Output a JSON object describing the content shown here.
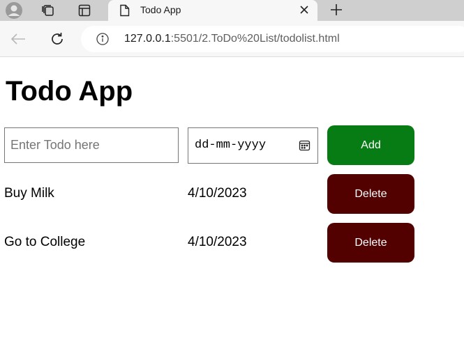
{
  "browser": {
    "tab_title": "Todo App",
    "url_host": "127.0.0.1",
    "url_rest": ":5501/2.ToDo%20List/todolist.html"
  },
  "page": {
    "title": "Todo App",
    "input_placeholder": "Enter Todo here",
    "date_placeholder": "dd-mm-yyyy",
    "add_label": "Add"
  },
  "todos": [
    {
      "name": "Buy Milk",
      "date": "4/10/2023",
      "delete_label": "Delete"
    },
    {
      "name": "Go to College",
      "date": "4/10/2023",
      "delete_label": "Delete"
    }
  ],
  "colors": {
    "add_button": "#077b14",
    "delete_button": "#520000"
  }
}
